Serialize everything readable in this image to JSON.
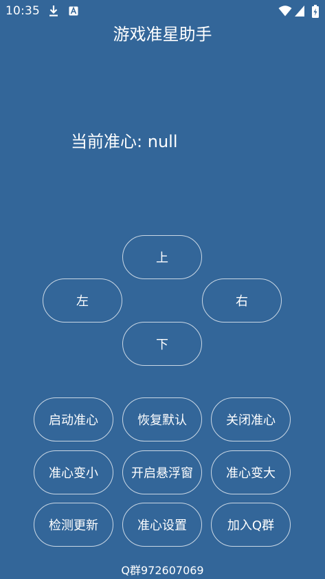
{
  "status_bar": {
    "time": "10:35",
    "icons": [
      "download-icon",
      "text-a-icon",
      "wifi-icon",
      "signal-icon",
      "battery-icon"
    ]
  },
  "app": {
    "title": "游戏准星助手"
  },
  "crosshair": {
    "label": "当前准心:",
    "value": "null"
  },
  "direction_pad": {
    "up": "上",
    "left": "左",
    "right": "右",
    "down": "下"
  },
  "actions": {
    "enable": "启动准心",
    "restore": "恢复默认",
    "disable": "关闭准心",
    "smaller": "准心变小",
    "floating": "开启悬浮窗",
    "larger": "准心变大",
    "update": "检测更新",
    "settings": "准心设置",
    "join_group": "加入Q群"
  },
  "footer": {
    "qq_group": "Q群972607069"
  },
  "colors": {
    "background": "#336699",
    "text": "#ffffff"
  }
}
